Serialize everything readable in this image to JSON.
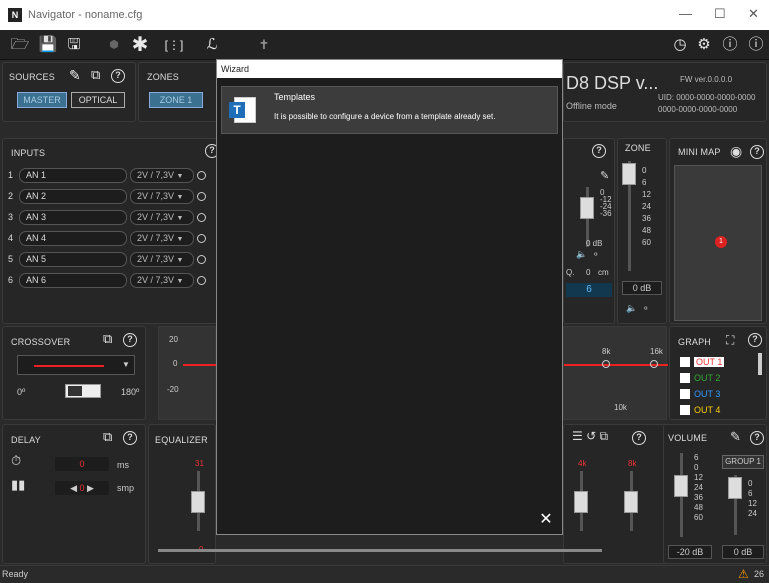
{
  "window": {
    "title": "Navigator - noname.cfg",
    "min": "—",
    "max": "☐",
    "close": "✕"
  },
  "toolbar": {
    "icons": [
      "folder-open",
      "save",
      "save-as",
      "lock",
      "asterisk",
      "matrix",
      "probe",
      "wand",
      "clock",
      "gear",
      "help",
      "info"
    ]
  },
  "sources": {
    "title": "SOURCES",
    "master": "MASTER",
    "optical": "OPTICAL"
  },
  "zones": {
    "title": "ZONES",
    "zone1": "ZONE 1"
  },
  "device": {
    "name": "D8 DSP v...",
    "status": "Offline mode",
    "fw": "FW ver.0.0.0.0",
    "uid1": "UID: 0000-0000-0000-0000",
    "uid2": "0000-0000-0000-0000"
  },
  "inputs": {
    "title": "INPUTS",
    "rows": [
      {
        "idx": "1",
        "name": "AN 1",
        "level": "2V / 7,3V"
      },
      {
        "idx": "2",
        "name": "AN 2",
        "level": "2V / 7,3V"
      },
      {
        "idx": "3",
        "name": "AN 3",
        "level": "2V / 7,3V"
      },
      {
        "idx": "4",
        "name": "AN 4",
        "level": "2V / 7,3V"
      },
      {
        "idx": "5",
        "name": "AN 5",
        "level": "2V / 7,3V"
      },
      {
        "idx": "6",
        "name": "AN 6",
        "level": "2V / 7,3V"
      }
    ]
  },
  "meter": {
    "scale": [
      "0",
      "-12",
      "-24",
      "-36"
    ],
    "db": "0 dB",
    "q": "Q.",
    "q_val": "0",
    "cm": "cm",
    "out_num": "6"
  },
  "zone_panel": {
    "title": "ZONE",
    "scale": [
      "0",
      "6",
      "12",
      "24",
      "36",
      "48",
      "60"
    ],
    "db": "0 dB"
  },
  "minimap": {
    "title": "MINI MAP",
    "marker": "1"
  },
  "crossover": {
    "title": "CROSSOVER",
    "deg0": "0º",
    "deg180": "180º",
    "axis": [
      "20",
      "0",
      "-20"
    ]
  },
  "graph_axis": {
    "f8k": "8k",
    "f16k": "16k",
    "f10k": "10k"
  },
  "graph": {
    "title": "GRAPH",
    "outs": [
      {
        "label": "OUT 1",
        "color": "#e33"
      },
      {
        "label": "OUT 2",
        "color": "#3a3"
      },
      {
        "label": "OUT 3",
        "color": "#39f"
      },
      {
        "label": "OUT 4",
        "color": "#fc0"
      }
    ]
  },
  "delay": {
    "title": "DELAY",
    "ms_val": "0",
    "ms": "ms",
    "smp_val": "0",
    "smp": "smp"
  },
  "equalizer": {
    "title": "EQUALIZER",
    "top_val": "31",
    "f4k": "4k",
    "f8k": "8k",
    "gain_val": "0"
  },
  "volume": {
    "title": "VOLUME",
    "scale": [
      "6",
      "0",
      "12",
      "24",
      "36",
      "48",
      "60"
    ],
    "db": "-20 dB",
    "group": "GROUP 1",
    "group_scale": [
      "0",
      "6",
      "12",
      "24"
    ],
    "group_db": "0 dB"
  },
  "wizard": {
    "title": "Wizard",
    "item_title": "Templates",
    "item_desc": "It is possible to configure a device from a template already set.",
    "close": "✕"
  },
  "status": {
    "text": "Ready",
    "warnings": "26"
  }
}
